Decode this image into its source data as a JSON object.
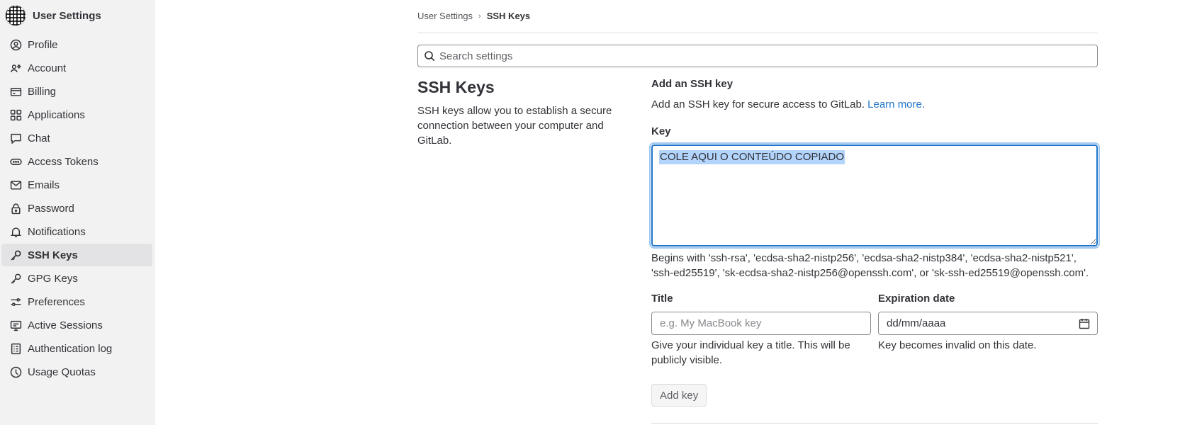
{
  "sidebar": {
    "title": "User Settings",
    "items": [
      {
        "label": "Profile",
        "icon": "profile-icon"
      },
      {
        "label": "Account",
        "icon": "account-icon"
      },
      {
        "label": "Billing",
        "icon": "billing-icon"
      },
      {
        "label": "Applications",
        "icon": "applications-icon"
      },
      {
        "label": "Chat",
        "icon": "chat-icon"
      },
      {
        "label": "Access Tokens",
        "icon": "token-icon"
      },
      {
        "label": "Emails",
        "icon": "mail-icon"
      },
      {
        "label": "Password",
        "icon": "lock-icon"
      },
      {
        "label": "Notifications",
        "icon": "bell-icon"
      },
      {
        "label": "SSH Keys",
        "icon": "key-icon",
        "active": true
      },
      {
        "label": "GPG Keys",
        "icon": "key-icon"
      },
      {
        "label": "Preferences",
        "icon": "preferences-icon"
      },
      {
        "label": "Active Sessions",
        "icon": "monitor-icon"
      },
      {
        "label": "Authentication log",
        "icon": "log-icon"
      },
      {
        "label": "Usage Quotas",
        "icon": "quota-icon"
      }
    ]
  },
  "breadcrumb": {
    "parent": "User Settings",
    "separator": "›",
    "current": "SSH Keys"
  },
  "search": {
    "placeholder": "Search settings"
  },
  "section": {
    "title": "SSH Keys",
    "description": "SSH keys allow you to establish a secure connection between your computer and GitLab."
  },
  "form": {
    "heading": "Add an SSH key",
    "intro": "Add an SSH key for secure access to GitLab.",
    "learn_more": "Learn more.",
    "key_label": "Key",
    "key_value": "COLE AQUI O CONTEÚDO COPIADO",
    "key_help": "Begins with 'ssh-rsa', 'ecdsa-sha2-nistp256', 'ecdsa-sha2-nistp384', 'ecdsa-sha2-nistp521', 'ssh-ed25519', 'sk-ecdsa-sha2-nistp256@openssh.com', or 'sk-ssh-ed25519@openssh.com'.",
    "title_label": "Title",
    "title_placeholder": "e.g. My MacBook key",
    "title_help": "Give your individual key a title. This will be publicly visible.",
    "expiration_label": "Expiration date",
    "expiration_placeholder": "dd/mm/aaaa",
    "expiration_help": "Key becomes invalid on this date.",
    "submit_label": "Add key"
  },
  "colors": {
    "accent": "#1f75cb",
    "sidebar_bg": "#f2f2f2",
    "active_item_bg": "#e3e3e6",
    "text": "#333238"
  }
}
